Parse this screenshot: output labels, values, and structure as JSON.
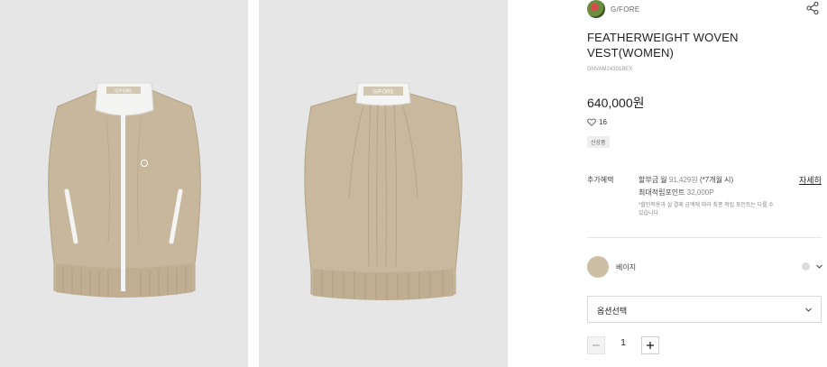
{
  "gallery": {
    "front_image": "vest-front-view",
    "back_image": "vest-back-view",
    "neck_label_front": "G/FORE",
    "neck_label_back": "G/FORE"
  },
  "product": {
    "brand": "G/FORE",
    "title": "FEATHERWEIGHT WOVEN VEST(WOMEN)",
    "sku": "GNVAM24301BEX",
    "price": "640,000원",
    "likes": "16",
    "tag": "신상품"
  },
  "benefits": {
    "label": "추가혜택",
    "installment_prefix": "할부금 월",
    "installment_amount": "91,429원",
    "installment_months": "(*7개월 시)",
    "detail_link": "자세히",
    "points_label": "최대적립포인트",
    "points_amount": "32,000P",
    "note": "*할인적용과 실 결제 금액에 따라 최종 적립 포인트는 다를 수 있습니다."
  },
  "color_option": {
    "name": "베이지",
    "swatch_color": "#cdbfa6"
  },
  "option_select": {
    "label": "옵션선택"
  },
  "quantity": {
    "value": "1"
  },
  "icons": {
    "share": "share-icon",
    "heart": "heart-icon",
    "chevron": "chevron-down-icon",
    "minus": "minus-icon",
    "plus": "plus-icon"
  }
}
